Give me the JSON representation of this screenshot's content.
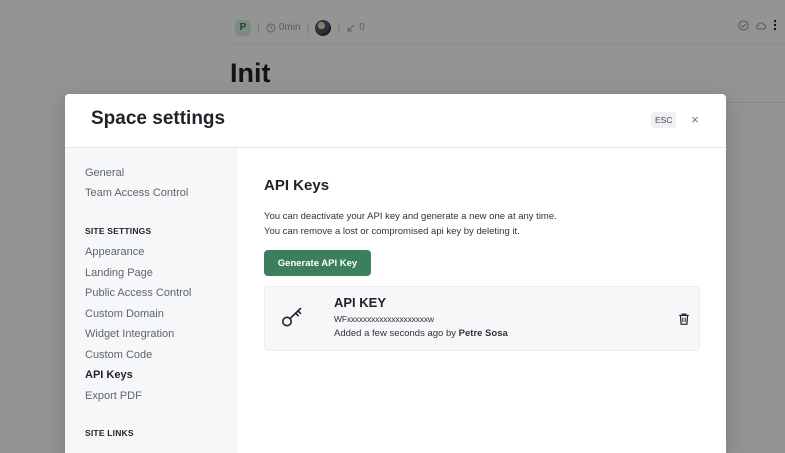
{
  "background": {
    "project_badge": "P",
    "timer": "0min",
    "merge_count": "0",
    "page_title": "Init"
  },
  "modal": {
    "title": "Space settings",
    "esc_label": "ESC",
    "close_label": "×"
  },
  "sidebar": {
    "items_top": [
      {
        "label": "General"
      },
      {
        "label": "Team Access Control"
      }
    ],
    "section_site_settings": "SITE SETTINGS",
    "items_site": [
      {
        "label": "Appearance"
      },
      {
        "label": "Landing Page"
      },
      {
        "label": "Public Access Control"
      },
      {
        "label": "Custom Domain"
      },
      {
        "label": "Widget Integration"
      },
      {
        "label": "Custom Code"
      },
      {
        "label": "API Keys",
        "active": true
      },
      {
        "label": "Export PDF"
      }
    ],
    "section_site_links": "SITE LINKS"
  },
  "content": {
    "title": "API Keys",
    "description_line1": "You can deactivate your API key and generate a new one at any time.",
    "description_line2": "You can remove a lost or compromised api key by deleting it.",
    "generate_button": "Generate API Key",
    "key_card": {
      "label": "API KEY",
      "value": "WFxxxxxxxxxxxxxxxxxxxxw",
      "added_prefix": "Added a few seconds ago by",
      "added_by": "Petre Sosa"
    }
  },
  "colors": {
    "accent": "#3c7f5c",
    "overlay": "rgba(0,0,0,0.42)",
    "sidebar_bg": "#f6f7f8"
  },
  "icons": {
    "key": "key-icon",
    "trash": "trash-icon",
    "close": "close-icon",
    "clock": "clock-icon",
    "merge": "merge-icon"
  }
}
